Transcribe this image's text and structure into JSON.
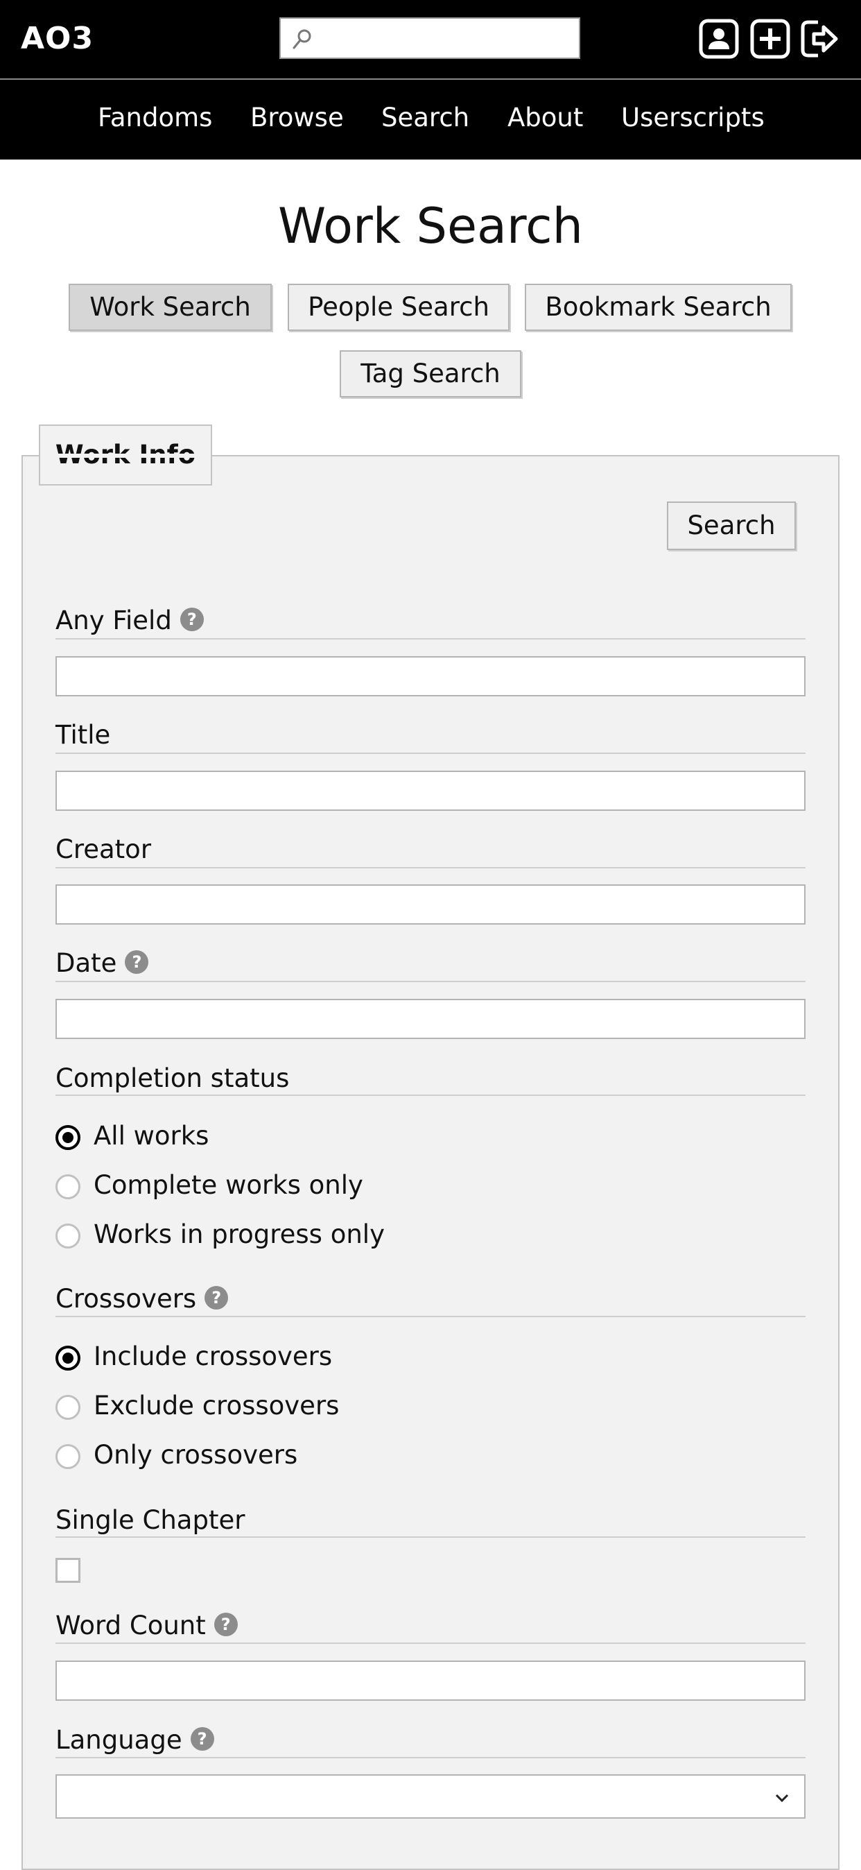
{
  "header": {
    "logo": "AO3",
    "search": {
      "value": "",
      "placeholder": ""
    },
    "icons": [
      "user-account-icon",
      "plus-icon",
      "logout-icon"
    ]
  },
  "nav": {
    "items": [
      "Fandoms",
      "Browse",
      "Search",
      "About",
      "Userscripts"
    ]
  },
  "page": {
    "title": "Work Search",
    "tabs": [
      {
        "label": "Work Search",
        "active": true
      },
      {
        "label": "People Search",
        "active": false
      },
      {
        "label": "Bookmark Search",
        "active": false
      },
      {
        "label": "Tag Search",
        "active": false
      }
    ]
  },
  "form": {
    "legend": "Work Info",
    "submit_label": "Search",
    "any_field": {
      "label": "Any Field",
      "value": ""
    },
    "title": {
      "label": "Title",
      "value": ""
    },
    "creator": {
      "label": "Creator",
      "value": ""
    },
    "date": {
      "label": "Date",
      "value": ""
    },
    "completion": {
      "label": "Completion status",
      "options": [
        "All works",
        "Complete works only",
        "Works in progress only"
      ],
      "selected": "All works"
    },
    "crossovers": {
      "label": "Crossovers",
      "options": [
        "Include crossovers",
        "Exclude crossovers",
        "Only crossovers"
      ],
      "selected": "Include crossovers"
    },
    "single_chapter": {
      "label": "Single Chapter",
      "checked": false
    },
    "word_count": {
      "label": "Word Count",
      "value": ""
    },
    "language": {
      "label": "Language",
      "value": ""
    },
    "help_glyph": "?"
  },
  "colors": {
    "header_bg": "#000000",
    "fieldset_bg": "#f2f2f2",
    "active_tab_bg": "#d6d6d6",
    "button_bg": "#efefef",
    "help_icon": "#8c8c8c"
  }
}
